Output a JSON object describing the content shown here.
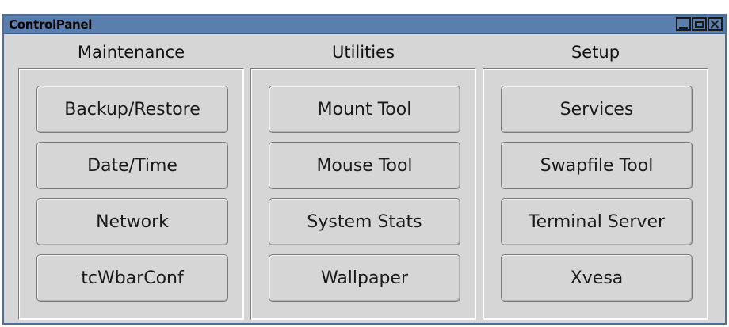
{
  "window": {
    "title": "ControlPanel",
    "controls": [
      "minimize-icon",
      "maximize-icon",
      "close-icon"
    ]
  },
  "groups": [
    {
      "title": "Maintenance",
      "buttons": [
        "Backup/Restore",
        "Date/Time",
        "Network",
        "tcWbarConf"
      ]
    },
    {
      "title": "Utilities",
      "buttons": [
        "Mount Tool",
        "Mouse Tool",
        "System Stats",
        "Wallpaper"
      ]
    },
    {
      "title": "Setup",
      "buttons": [
        "Services",
        "Swapfile Tool",
        "Terminal Server",
        "Xvesa"
      ]
    }
  ],
  "colors": {
    "titlebar": "#5a7fae",
    "window_bg": "#d6d6d6",
    "button_bg": "#d6d6d6"
  }
}
